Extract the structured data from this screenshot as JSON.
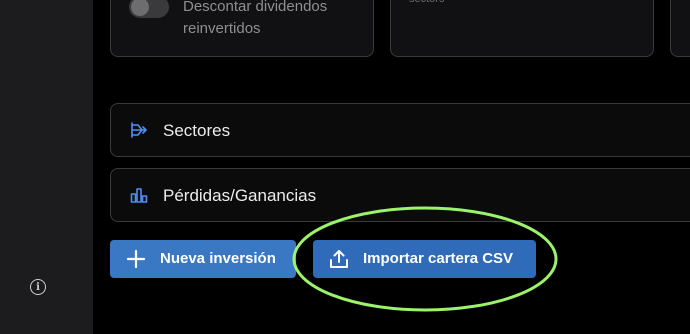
{
  "sidebar": {
    "info_icon": "info-icon",
    "info_glyph": "i"
  },
  "cards": {
    "reinvest_toggle": {
      "label": "Descontar dividendos reinvertidos",
      "enabled": false
    },
    "partial_text": "sectors"
  },
  "sections": [
    {
      "label": "Sectores",
      "icon": "sector-flow-icon"
    },
    {
      "label": "Pérdidas/Ganancias",
      "icon": "bar-chart-icon"
    }
  ],
  "actions": {
    "new_investment": {
      "label": "Nueva inversión",
      "icon": "plus-icon"
    },
    "import_csv": {
      "label": "Importar cartera CSV",
      "icon": "upload-icon"
    }
  },
  "annotation": {
    "color": "#9bf26b",
    "shape": "ellipse"
  },
  "colors": {
    "accent_button": "#3b78c4",
    "icon_blue": "#4f8ef7",
    "background": "#000000",
    "sidebar": "#1c1c1e"
  }
}
